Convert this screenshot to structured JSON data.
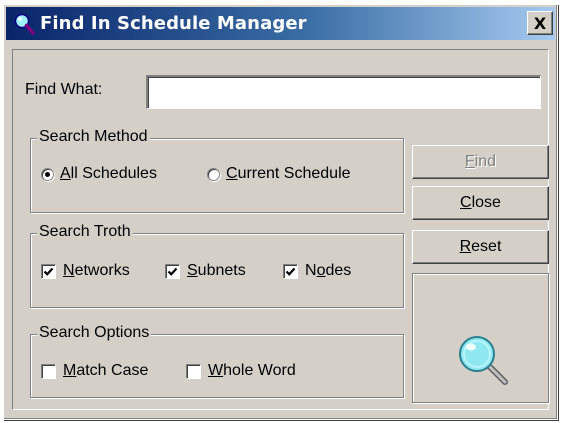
{
  "window": {
    "title": "Find In Schedule Manager",
    "title_icon": "magnifier-icon",
    "close_glyph": "X"
  },
  "find_what": {
    "label": "Find What:",
    "value": "",
    "placeholder": ""
  },
  "search_method": {
    "title": "Search Method",
    "options": [
      {
        "label": "All Schedules",
        "mnemonic": "A",
        "selected": true
      },
      {
        "label": "Current Schedule",
        "mnemonic": "C",
        "selected": false
      }
    ]
  },
  "search_troth": {
    "title": "Search Troth",
    "options": [
      {
        "label": "Networks",
        "checked": true
      },
      {
        "label": "Subnets",
        "checked": true
      },
      {
        "label": "Nodes",
        "checked": true
      }
    ]
  },
  "search_options": {
    "title": "Search Options",
    "options": [
      {
        "label": "Match Case",
        "checked": false
      },
      {
        "label": "Whole Word",
        "checked": false
      }
    ]
  },
  "buttons": {
    "find": {
      "label": "Find",
      "enabled": false
    },
    "close": {
      "label": "Close",
      "enabled": true
    },
    "reset": {
      "label": "Reset",
      "enabled": true
    }
  },
  "panel_icon": "magnifier-icon",
  "colors": {
    "title_gradient_start": "#0a246a",
    "title_gradient_end": "#a6caf0",
    "face": "#d4d0c8",
    "lens": "#8fe8f0"
  }
}
